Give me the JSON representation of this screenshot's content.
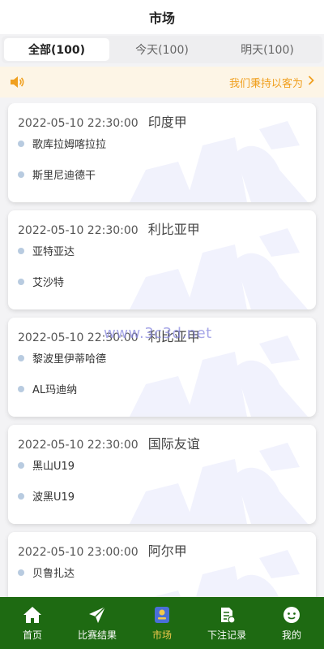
{
  "header": {
    "title": "市场"
  },
  "tabs": [
    {
      "label": "全部(100)"
    },
    {
      "label": "今天(100)"
    },
    {
      "label": "明天(100)"
    }
  ],
  "notice": {
    "text": "我们秉持以客为"
  },
  "watermark_text": "www.3c3d.net",
  "matches": [
    {
      "time": "2022-05-10 22:30:00",
      "league": "印度甲",
      "home": "歌库拉姆喀拉拉",
      "away": "斯里尼迪德干"
    },
    {
      "time": "2022-05-10 22:30:00",
      "league": "利比亚甲",
      "home": "亚特亚达",
      "away": "艾沙特"
    },
    {
      "time": "2022-05-10 22:30:00",
      "league": "利比亚甲",
      "home": "黎波里伊蒂哈德",
      "away": "AL玛迪纳"
    },
    {
      "time": "2022-05-10 22:30:00",
      "league": "国际友谊",
      "home": "黑山U19",
      "away": "波黑U19"
    },
    {
      "time": "2022-05-10 23:00:00",
      "league": "阿尔甲",
      "home": "贝鲁扎达",
      "away": ""
    }
  ],
  "tabbar": [
    {
      "label": "首页",
      "icon": "home-icon"
    },
    {
      "label": "比赛结果",
      "icon": "send-icon"
    },
    {
      "label": "市场",
      "icon": "market-icon"
    },
    {
      "label": "下注记录",
      "icon": "record-icon"
    },
    {
      "label": "我的",
      "icon": "profile-icon"
    }
  ],
  "colors": {
    "accent": "#f0a020",
    "tabbar_bg": "#1e6a12",
    "tabbar_active": "#f2c94c"
  }
}
